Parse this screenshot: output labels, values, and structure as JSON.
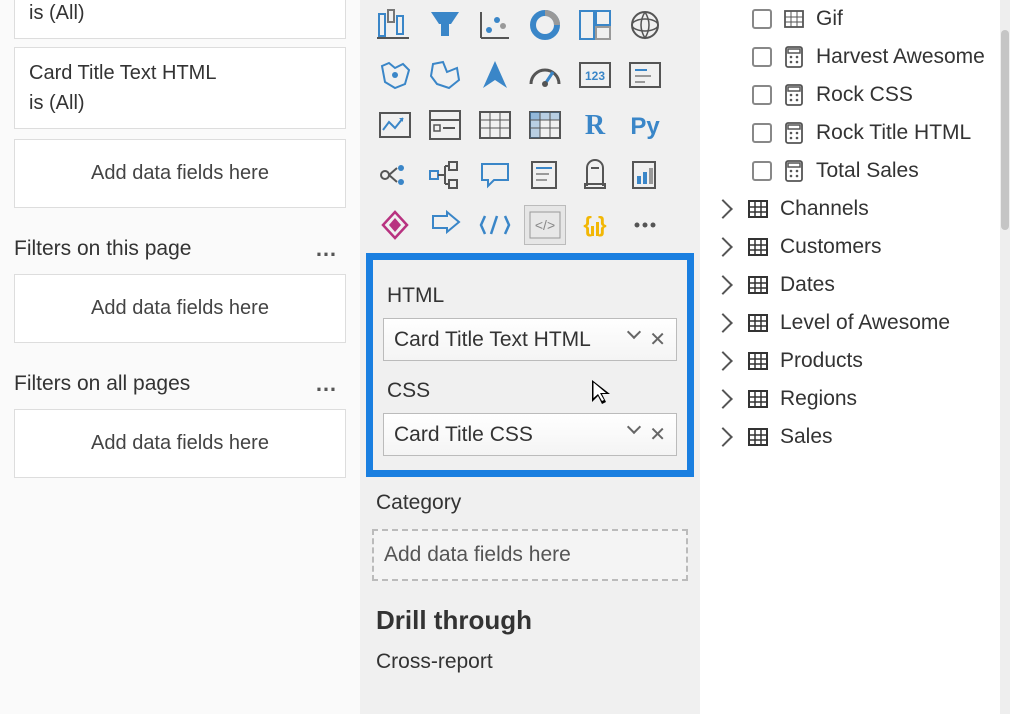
{
  "filters": {
    "partial_top": "is (All)",
    "card1_line1": "Card Title Text HTML",
    "card1_line2": "is (All)",
    "add_here": "Add data fields here",
    "section_page": "Filters on this page",
    "section_all": "Filters on all pages"
  },
  "viz": {
    "well_html": "HTML",
    "chip_html": "Card Title Text HTML",
    "well_css": "CSS",
    "chip_css": "Card Title CSS",
    "category": "Category",
    "add_here": "Add data fields here",
    "drill": "Drill through",
    "cross": "Cross-report"
  },
  "fields": {
    "items_checkbox": [
      {
        "label": "Gif",
        "icon": "table"
      },
      {
        "label": "Harvest Awesome",
        "icon": "calc"
      },
      {
        "label": "Rock CSS",
        "icon": "calc"
      },
      {
        "label": "Rock Title HTML",
        "icon": "calc"
      },
      {
        "label": "Total Sales",
        "icon": "calc"
      }
    ],
    "tables": [
      "Channels",
      "Customers",
      "Dates",
      "Level of Awesome",
      "Products",
      "Regions",
      "Sales"
    ]
  }
}
